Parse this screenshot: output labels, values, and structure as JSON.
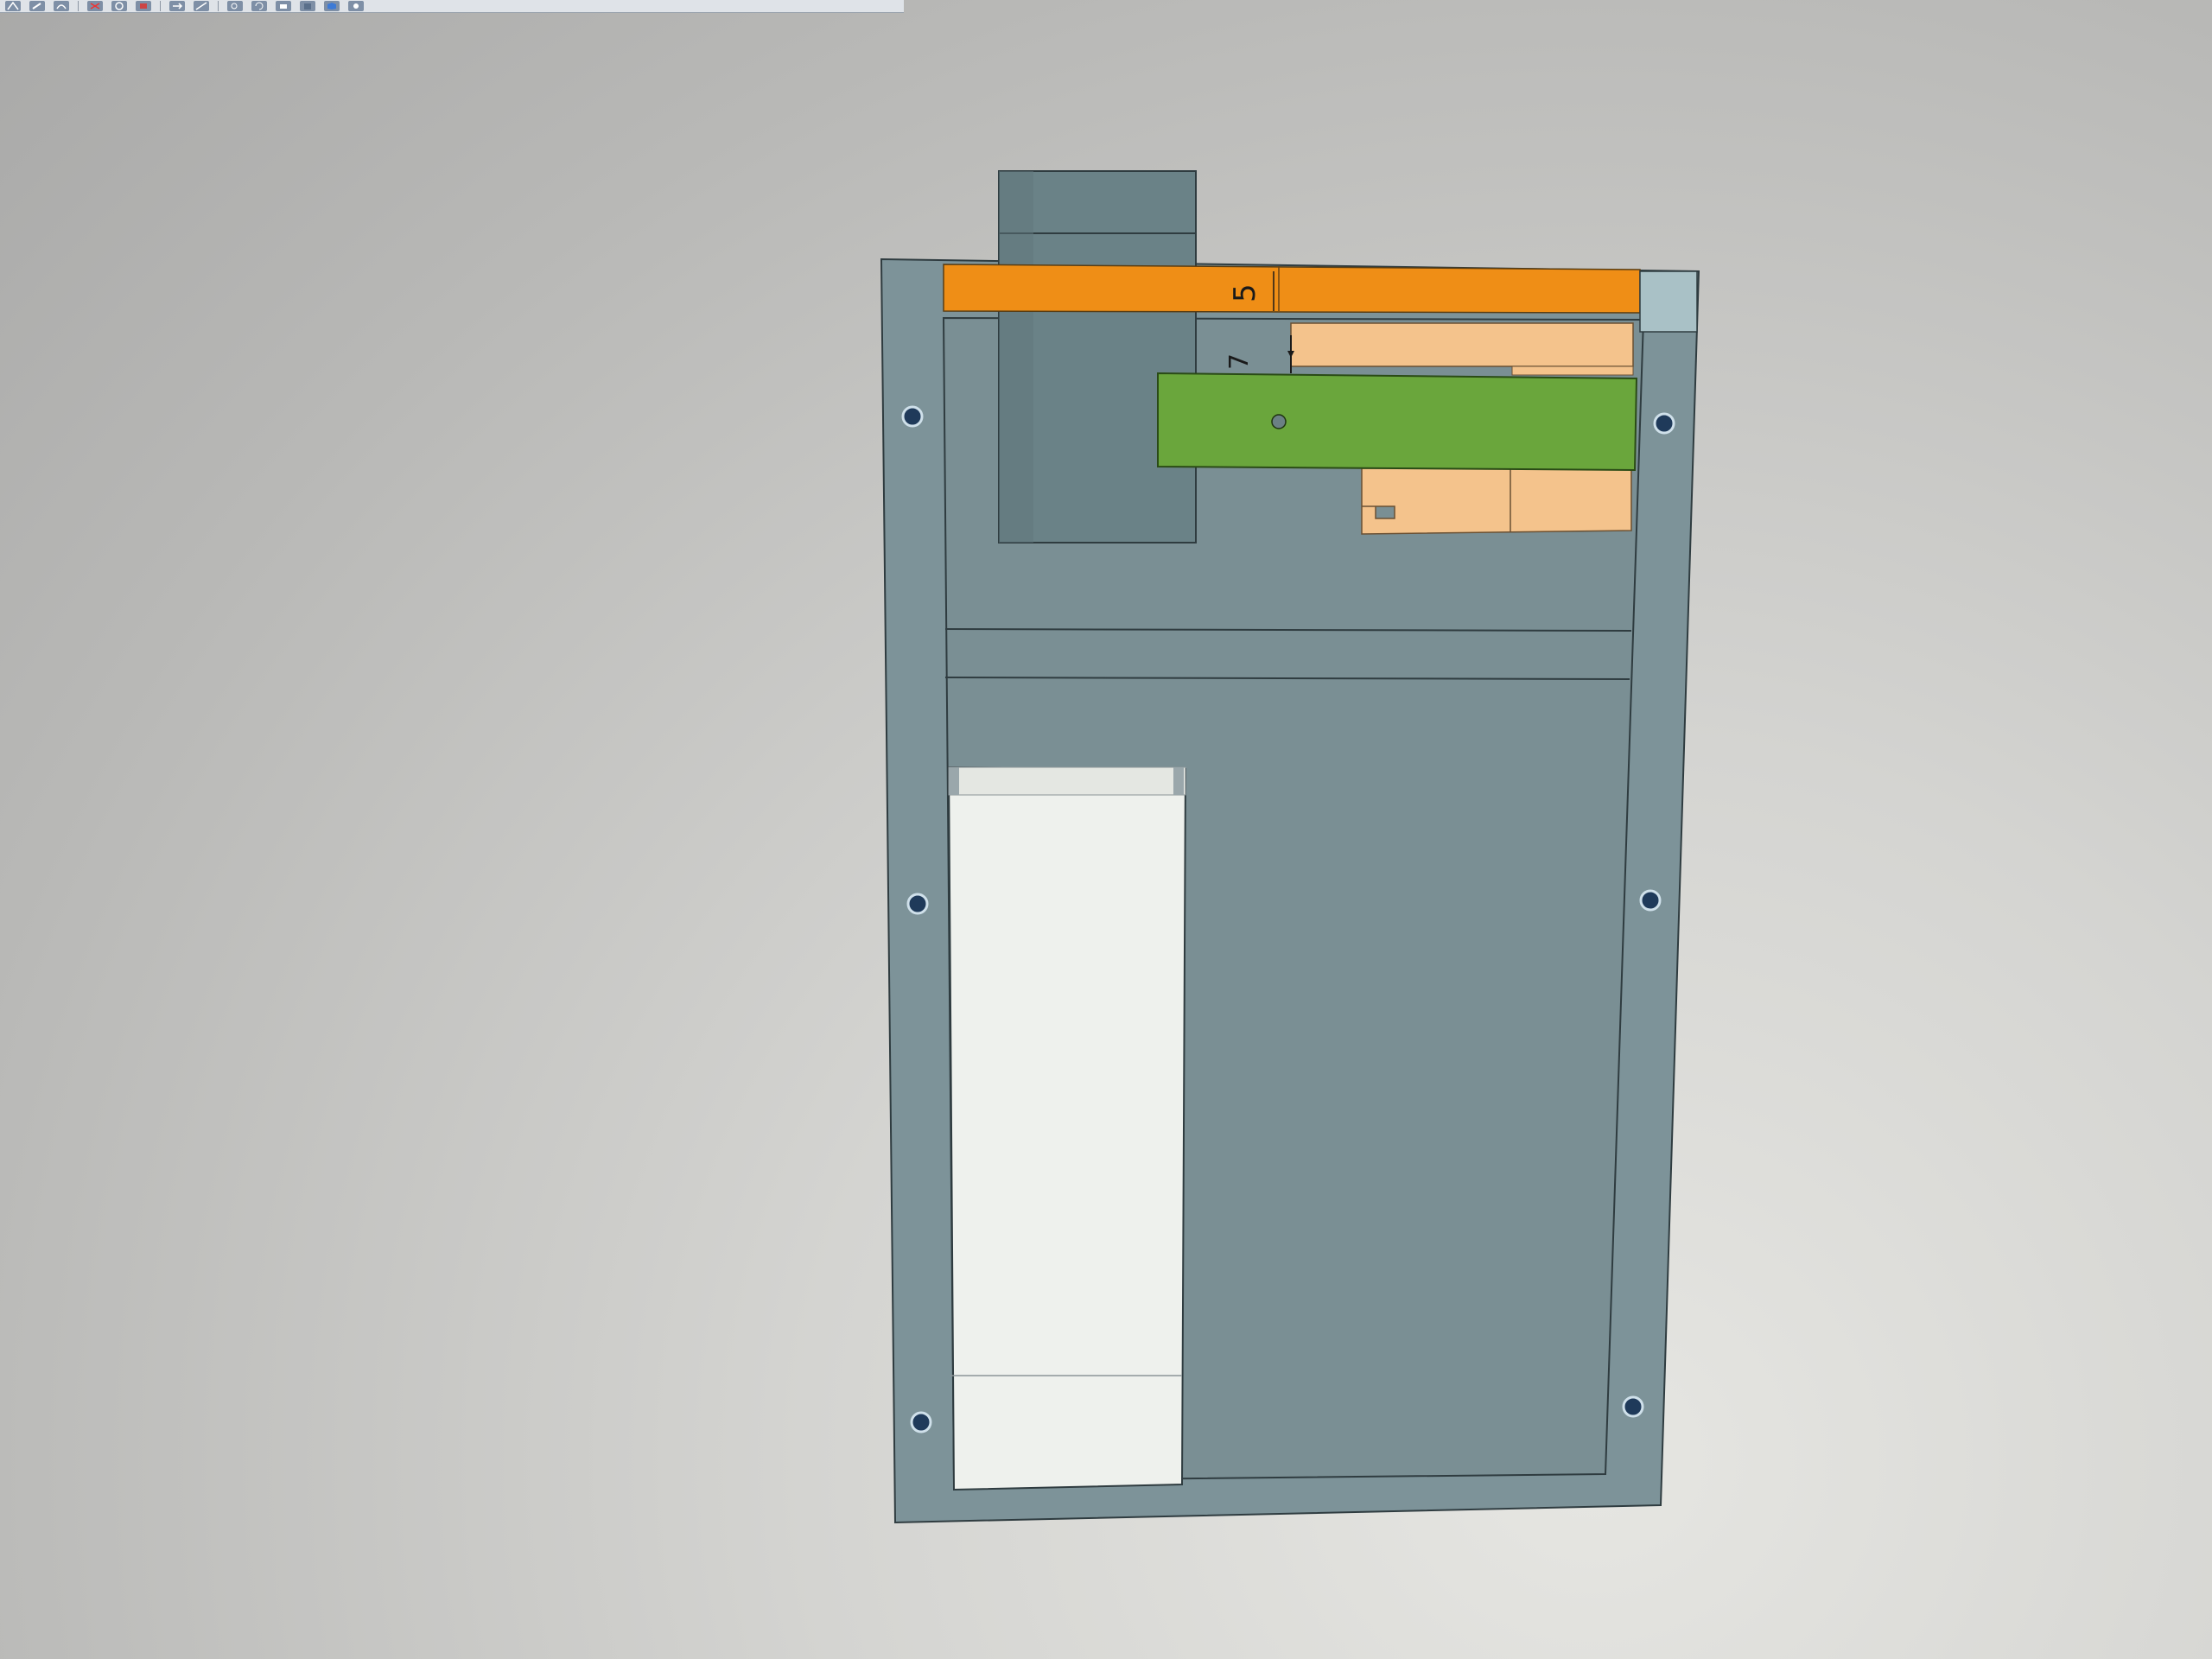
{
  "toolbar": {
    "icons": [
      "sketch-icon",
      "pencil-icon",
      "arc-icon",
      "trim-icon",
      "circle-icon",
      "shape-icon",
      "arrow-icon",
      "view-icon",
      "zoom-icon",
      "rotate-icon",
      "print-icon",
      "box-icon",
      "cube-icon",
      "settings-icon"
    ]
  },
  "model": {
    "dimension_5": "5",
    "dimension_7": "7"
  },
  "colors": {
    "frame": "#7d9399",
    "panel": "#7a8f94",
    "orange_bar": "#ef8e16",
    "peach": "#f4c38c",
    "green": "#6aa63c",
    "cylinder": "#6a8287",
    "opening": "#eef1ed",
    "corner_block": "#a9c1c6"
  }
}
